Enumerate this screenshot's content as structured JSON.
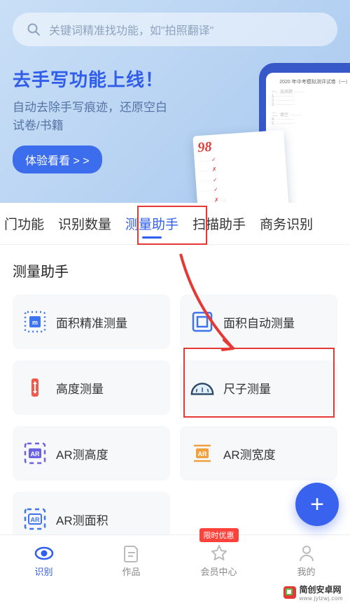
{
  "search": {
    "placeholder": "关键词精准找功能，如\"拍照翻译\""
  },
  "banner": {
    "title": "去手写功能上线！",
    "subtitle": "自动去除手写痕迹，还原空白试卷/书籍",
    "button": "体验看看 > >",
    "score": "98"
  },
  "tabs": [
    {
      "label": "门功能",
      "key": "partial"
    },
    {
      "label": "识别数量",
      "key": "count"
    },
    {
      "label": "测量助手",
      "key": "measure",
      "active": true
    },
    {
      "label": "扫描助手",
      "key": "scan"
    },
    {
      "label": "商务识别",
      "key": "business"
    }
  ],
  "section": {
    "title": "测量助手"
  },
  "tools": [
    {
      "label": "面积精准测量",
      "icon": "area-precise",
      "color": "#3e74ef"
    },
    {
      "label": "面积自动测量",
      "icon": "area-auto",
      "color": "#3e74ef"
    },
    {
      "label": "高度测量",
      "icon": "height",
      "color": "#f05a4a"
    },
    {
      "label": "尺子测量",
      "icon": "ruler",
      "color": "#2d4766"
    },
    {
      "label": "AR测高度",
      "icon": "ar",
      "color": "#6a62e3",
      "badge": "AR"
    },
    {
      "label": "AR测宽度",
      "icon": "ar",
      "color": "#f0a13e",
      "badge": "AR"
    },
    {
      "label": "AR测面积",
      "icon": "ar",
      "color": "#3e74ef",
      "badge": "AR"
    }
  ],
  "nav": [
    {
      "label": "识别",
      "icon": "eye",
      "active": true
    },
    {
      "label": "作品",
      "icon": "doc"
    },
    {
      "label": "会员中心",
      "icon": "star",
      "badge": "限时优惠"
    },
    {
      "label": "我的",
      "icon": "person"
    }
  ],
  "annotation": {
    "arrow_color": "#e53935"
  },
  "watermark": {
    "name": "简创安卓网",
    "url": "www.jylzwj.com"
  }
}
